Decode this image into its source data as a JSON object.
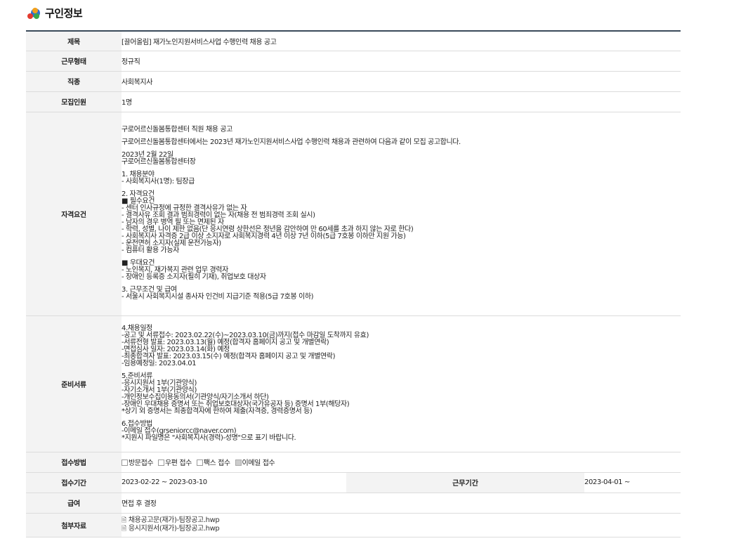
{
  "header": {
    "title": "구인정보"
  },
  "rows": {
    "title": {
      "label": "제목",
      "value": "[끌어올림] 재가노인지원서비스사업 수행인력 채용 공고"
    },
    "work_type": {
      "label": "근무형태",
      "value": "정규직"
    },
    "job": {
      "label": "직종",
      "value": "사회복지사"
    },
    "headcount": {
      "label": "모집인원",
      "value": "1명"
    },
    "qualification": {
      "label": "자격요건",
      "lines": [
        "구로어르신돌봄통합센터 직원 채용 공고",
        "",
        "구로어르신돌봄통합센터에서는 2023년 재가노인지원서비스사업 수행인력 채용과 관련하여 다음과 같이 모집 공고합니다.",
        "",
        "2023년 2월 22일",
        "구로어르신돌봄통합센터장",
        "",
        "1. 채용분야",
        "- 사회복지사(1명): 팀장급",
        "",
        "2. 자격요건",
        "■ 필수요건",
        "- 센터 인사규정에 규정한 결격사유가 없는 자",
        "- 결격사유 조회 결과 범죄경력이 없는 자(채용 전 범죄경력 조회 실시)",
        "- 남자의 경우 병역 필 또는 면제된 자",
        "- 학력, 성별, 나이 제한 없음(단 응시연령 상한선은 정년을 감안하여 만 60세를 초과 하지 않는 자로 한다)",
        "- 사회복지사 자격증 2급 이상 소지자로 사회복지경력 4년 이상 7년 이하(5급 7호봉 이하만 지원 가능)",
        "- 운전면허 소지자(실제 운전가능자)",
        "- 컴퓨터 활용 가능자",
        "",
        "■ 우대요건",
        "- 노인복지, 재가복지 관련 업무 경력자",
        "- 장애인 등록증 소지자(필히 기재), 취업보호 대상자",
        "",
        "3. 근무조건 및 급여",
        "- 서울시 사회복지시설 종사자 인건비 지급기준 적용(5급 7호봉 이하)"
      ]
    },
    "documents": {
      "label": "준비서류",
      "lines": [
        "4.채용일정",
        "-공고 및 서류접수: 2023.02.22(수)~2023.03.10(금)까지(접수 마감일 도착까지 유효)",
        "-서류전형 발표: 2023.03.13(월) 예정(합격자 홈페이지 공고 및 개별연락)",
        "-면접심사 일자: 2023.03.14(화) 예정",
        "-최종합격자 발표: 2023.03.15(수) 예정(합격자 홈페이지 공고 및 개별연락)",
        "-임용예정일: 2023.04.01",
        "",
        "5.준비서류",
        "-응시지원서 1부(기관양식)",
        "-자기소개서 1부(기관양식)",
        "-개인정보수집이용동의서(기관양식/자기소개서 하단)",
        "-장애인 우대채용 증명서 또는 취업보호대상자(국가유공자 등) 증명서 1부(해당자)",
        "*상기 외 증명서는 최종합격자에 한하여 제출(자격증, 경력증명서 등)",
        "",
        "6.접수방법",
        "-이메일 접수(grseniorcc@naver.com)",
        " *지원시 파일명은 \"사회복지사(경력)-성명\"으로 표기 바랍니다."
      ]
    },
    "apply_method": {
      "label": "접수방법",
      "options": [
        {
          "label": "방문접수",
          "checked": false
        },
        {
          "label": "우편 접수",
          "checked": false
        },
        {
          "label": "팩스 접수",
          "checked": false
        },
        {
          "label": "이메일 접수",
          "checked": true
        }
      ]
    },
    "period": {
      "label": "접수기간",
      "value": "2023-02-22 ~ 2023-03-10",
      "label2": "근무기간",
      "value2": "2023-04-01 ~"
    },
    "salary": {
      "label": "급여",
      "value": "면접 후 결정"
    },
    "attachments": {
      "label": "첨부자료",
      "files": [
        "채용공고문(재가)-팀장공고.hwp",
        "응시지원서(재가)-팀장공고.hwp"
      ]
    }
  }
}
